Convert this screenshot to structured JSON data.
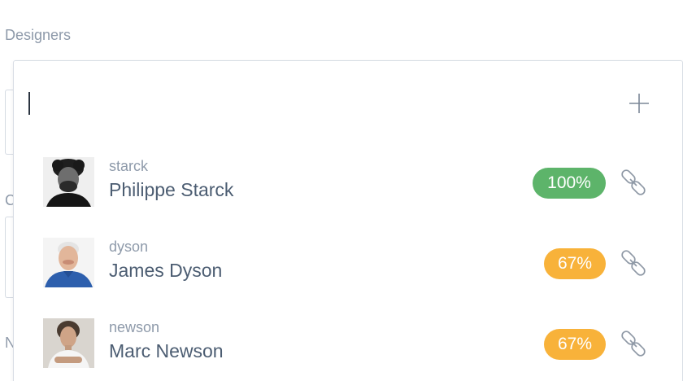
{
  "field": {
    "label": "Designers",
    "behind_letter_1": "C",
    "behind_letter_2": "N"
  },
  "search": {
    "value": "",
    "placeholder": "",
    "add_icon": "plus-icon"
  },
  "results": [
    {
      "username": "starck",
      "name": "Philippe Starck",
      "match": "100%",
      "match_color": "#5db46a",
      "action_icon": "link-icon"
    },
    {
      "username": "dyson",
      "name": "James Dyson",
      "match": "67%",
      "match_color": "#f8b23a",
      "action_icon": "link-icon"
    },
    {
      "username": "newson",
      "name": "Marc Newson",
      "match": "67%",
      "match_color": "#f8b23a",
      "action_icon": "link-icon"
    }
  ]
}
